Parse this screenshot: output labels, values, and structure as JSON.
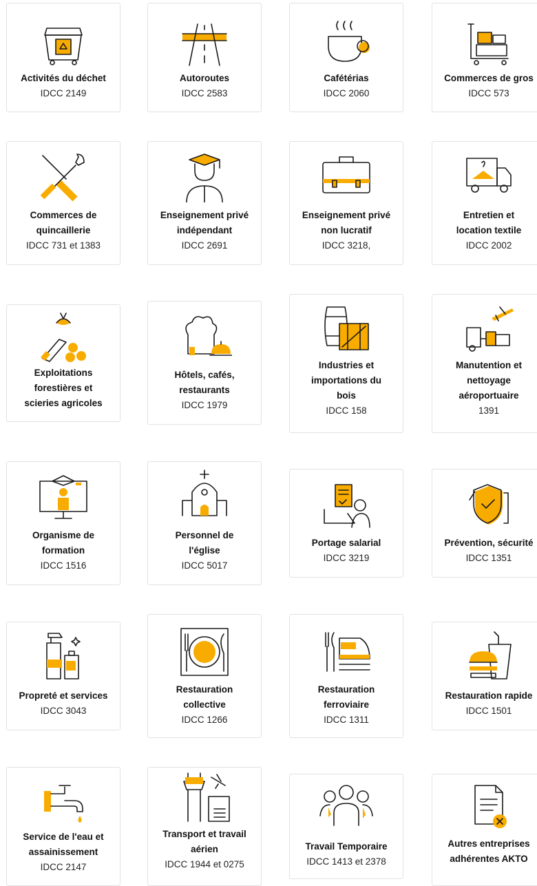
{
  "accent_color": "#f9ac00",
  "cards": [
    {
      "name": "Activités du déchet",
      "code": "IDCC 2149",
      "icon": "recycling-bin-icon"
    },
    {
      "name": "Autoroutes",
      "code": "IDCC 2583",
      "icon": "highway-icon"
    },
    {
      "name": "Cafétérias",
      "code": "IDCC 2060",
      "icon": "coffee-cup-icon"
    },
    {
      "name": "Commerces de gros",
      "code": "IDCC 573",
      "icon": "trolley-icon"
    },
    {
      "name": "Commerces de\nquincaillerie",
      "code": "IDCC 731 et 1383",
      "icon": "tools-icon"
    },
    {
      "name": "Enseignement privé\nindépendant",
      "code": "IDCC 2691",
      "icon": "graduate-icon"
    },
    {
      "name": "Enseignement privé\nnon lucratif",
      "code": "IDCC 3218,",
      "icon": "briefcase-icon"
    },
    {
      "name": "Entretien et\nlocation textile",
      "code": "IDCC 2002",
      "icon": "laundry-truck-icon"
    },
    {
      "name": "Exploitations\nforestières et\nscieries agricoles",
      "code": "",
      "icon": "chainsaw-logs-icon"
    },
    {
      "name": "Hôtels, cafés,\nrestaurants",
      "code": "IDCC 1979",
      "icon": "chef-hat-bell-icon"
    },
    {
      "name": "Industries et\nimportations du\nbois",
      "code": "IDCC 158",
      "icon": "barrel-crate-icon"
    },
    {
      "name": "Manutention et\nnettoyage\naéroportuaire",
      "code": "1391",
      "icon": "airport-truck-icon"
    },
    {
      "name": "Organisme de\nformation",
      "code": "IDCC 1516",
      "icon": "training-screen-icon"
    },
    {
      "name": "Personnel de\nl'église",
      "code": "IDCC 5017",
      "icon": "church-icon"
    },
    {
      "name": "Portage salarial",
      "code": "IDCC 3219",
      "icon": "freelancer-laptop-icon"
    },
    {
      "name": "Prévention, sécurité",
      "code": "IDCC 1351",
      "icon": "security-shield-icon"
    },
    {
      "name": "Propreté et services",
      "code": "IDCC 3043",
      "icon": "cleaning-products-icon"
    },
    {
      "name": "Restauration\ncollective",
      "code": "IDCC 1266",
      "icon": "plate-cutlery-icon"
    },
    {
      "name": "Restauration\nferroviaire",
      "code": "IDCC 1311",
      "icon": "train-cutlery-icon"
    },
    {
      "name": "Restauration rapide",
      "code": "IDCC 1501",
      "icon": "burger-drink-icon"
    },
    {
      "name": "Service de l'eau et\nassainissement",
      "code": "IDCC 2147",
      "icon": "water-tap-icon"
    },
    {
      "name": "Transport et travail\naérien",
      "code": "IDCC 1944 et 0275",
      "icon": "control-tower-icon"
    },
    {
      "name": "Travail Temporaire",
      "code": "IDCC 1413 et 2378",
      "icon": "temp-workers-icon"
    },
    {
      "name": "Autres entreprises\nadhérentes AKTO",
      "code": "",
      "icon": "document-cancel-icon"
    }
  ]
}
